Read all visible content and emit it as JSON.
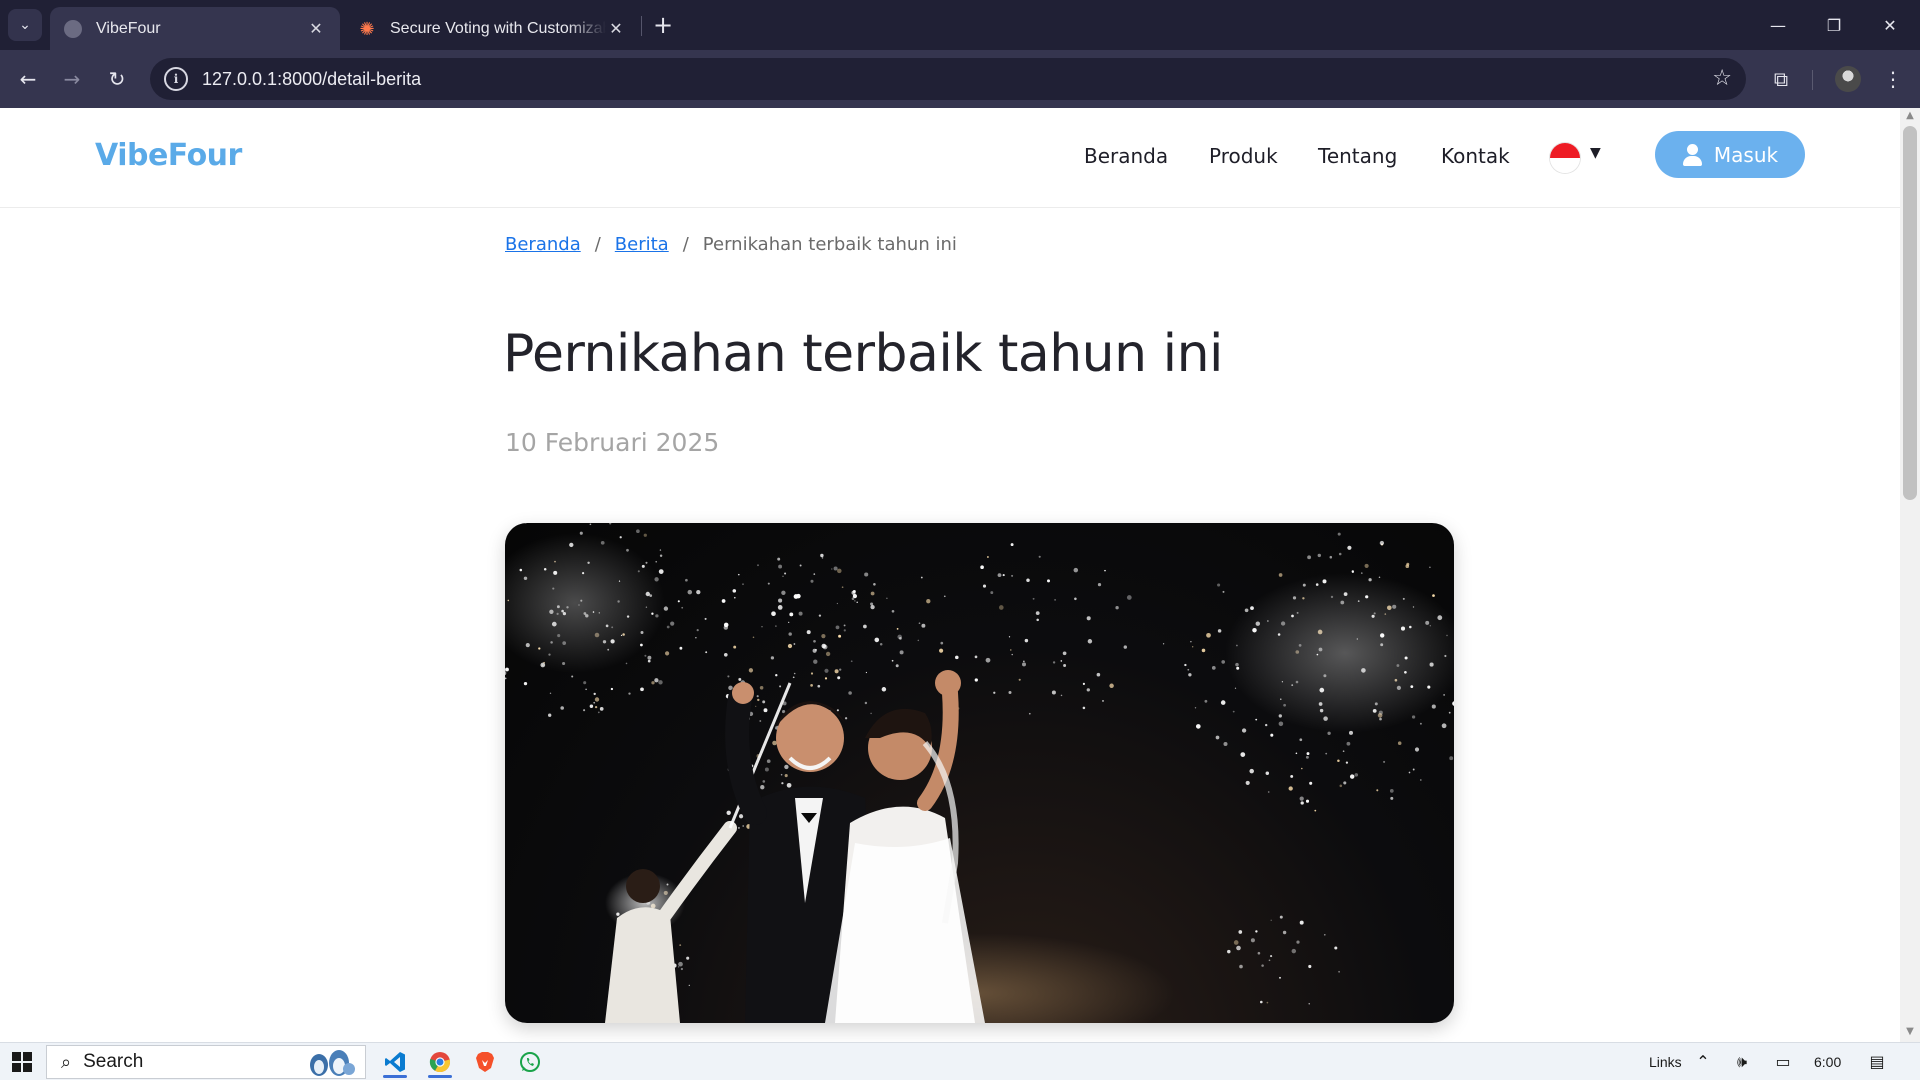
{
  "browser": {
    "tab_search_icon": "chevron-down-icon",
    "tabs": [
      {
        "title": "VibeFour",
        "active": true
      },
      {
        "title": "Secure Voting with Customizable",
        "active": false
      }
    ],
    "url": "127.0.0.1:8000/detail-berita"
  },
  "site": {
    "brand": "VibeFour",
    "brand_color": "#5aaae8",
    "nav": [
      {
        "label": "Beranda"
      },
      {
        "label": "Produk"
      },
      {
        "label": "Tentang"
      },
      {
        "label": "Kontak"
      }
    ],
    "language_flag": "indonesia-flag",
    "login_label": "Masuk",
    "login_color": "#6bb1ee"
  },
  "breadcrumb": {
    "home": "Beranda",
    "section": "Berita",
    "current": "Pernikahan terbaik tahun ini",
    "separator": "/"
  },
  "article": {
    "title": "Pernikahan terbaik tahun ini",
    "date": "10 Februari 2025",
    "image_alt": "wedding couple with sparkler fireworks"
  },
  "taskbar": {
    "search_placeholder": "Search",
    "links_label": "Links",
    "time": "6:00"
  }
}
